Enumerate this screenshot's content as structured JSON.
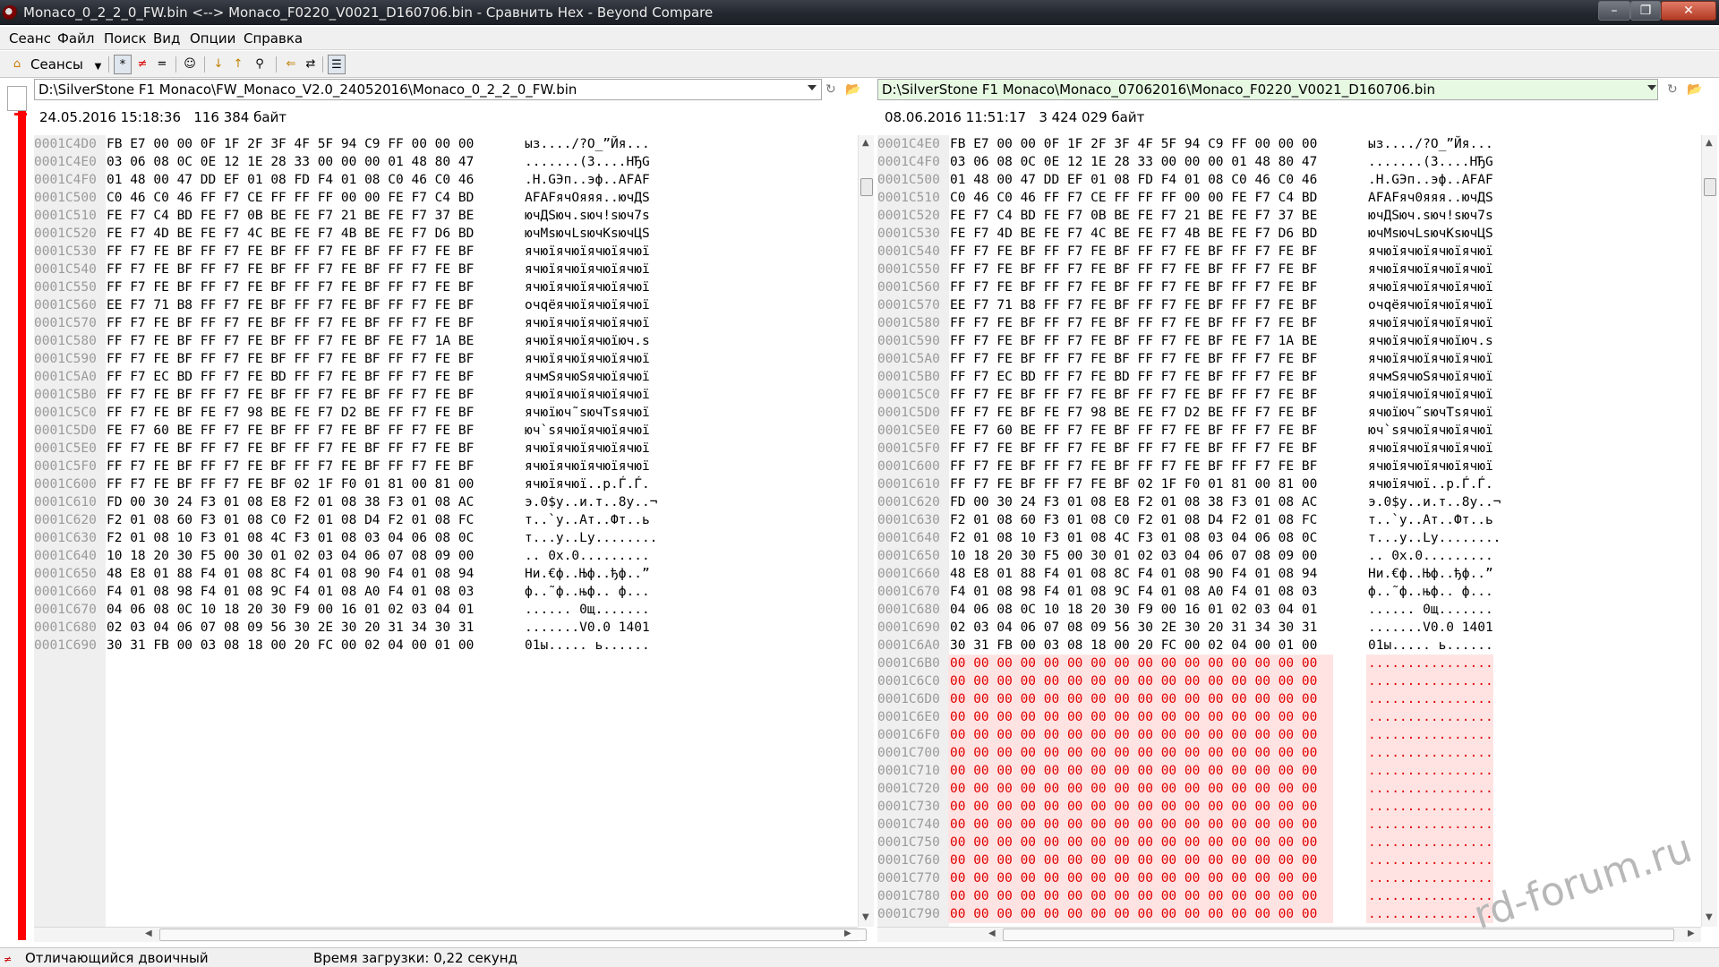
{
  "window": {
    "title": "Monaco_0_2_2_0_FW.bin <--> Monaco_F0220_V0021_D160706.bin - Сравнить Hex - Beyond Compare",
    "buttons": {
      "minimize": "–",
      "maximize": "❐",
      "close": "✕"
    }
  },
  "menu": [
    "Сеанс",
    "Файл",
    "Поиск",
    "Вид",
    "Опции",
    "Справка"
  ],
  "toolbar": {
    "sessions_label": "Сеансы",
    "icons": [
      "home-icon",
      "show-all-icon",
      "show-diffs-icon",
      "show-same-icon",
      "rules-icon",
      "prev-diff-icon",
      "next-diff-icon",
      "find-icon",
      "copy-icon",
      "swap-icon",
      "details-icon"
    ]
  },
  "left": {
    "path": "D:\\SilverStone F1 Monaco\\FW_Monaco_V2.0_24052016\\Monaco_0_2_2_0_FW.bin",
    "info": "24.05.2016 15:18:36   116 384 байт",
    "rows": [
      {
        "addr": "0001C4D0",
        "hex": "FB E7 00 00 0F 1F 2F 3F 4F 5F 94 C9 FF 00 00 00",
        "text": "ыз..../?O_”Йя..."
      },
      {
        "addr": "0001C4E0",
        "hex": "03 06 08 0C 0E 12 1E 28 33 00 00 00 01 48 80 47",
        "text": ".......(3....HЂG"
      },
      {
        "addr": "0001C4F0",
        "hex": "01 48 00 47 DD EF 01 08 FD F4 01 08 C0 46 C0 46",
        "text": ".H.GЭп..эф..AFAF"
      },
      {
        "addr": "0001C500",
        "hex": "C0 46 C0 46 FF F7 CE FF FF FF 00 00 FE F7 C4 BD",
        "text": "AFAFячОяяя..ючДЅ"
      },
      {
        "addr": "0001C510",
        "hex": "FE F7 C4 BD FE F7 0B BE FE F7 21 BE FE F7 37 BE",
        "text": "ючДЅюч.ѕюч!ѕюч7ѕ"
      },
      {
        "addr": "0001C520",
        "hex": "FE F7 4D BE FE F7 4C BE FE F7 4B BE FE F7 D6 BD",
        "text": "ючMѕючLѕючKѕючЦЅ"
      },
      {
        "addr": "0001C530",
        "hex": "FF F7 FE BF FF F7 FE BF FF F7 FE BF FF F7 FE BF",
        "text": "ячюїячюїячюїячюї"
      },
      {
        "addr": "0001C540",
        "hex": "FF F7 FE BF FF F7 FE BF FF F7 FE BF FF F7 FE BF",
        "text": "ячюїячюїячюїячюї"
      },
      {
        "addr": "0001C550",
        "hex": "FF F7 FE BF FF F7 FE BF FF F7 FE BF FF F7 FE BF",
        "text": "ячюїячюїячюїячюї"
      },
      {
        "addr": "0001C560",
        "hex": "EE F7 71 B8 FF F7 FE BF FF F7 FE BF FF F7 FE BF",
        "text": "очqёячюїячюїячюї"
      },
      {
        "addr": "0001C570",
        "hex": "FF F7 FE BF FF F7 FE BF FF F7 FE BF FF F7 FE BF",
        "text": "ячюїячюїячюїячюї"
      },
      {
        "addr": "0001C580",
        "hex": "FF F7 FE BF FF F7 FE BF FF F7 FE BF FE F7 1A BE",
        "text": "ячюїячюїячюїюч.ѕ"
      },
      {
        "addr": "0001C590",
        "hex": "FF F7 FE BF FF F7 FE BF FF F7 FE BF FF F7 FE BF",
        "text": "ячюїячюїячюїячюї"
      },
      {
        "addr": "0001C5A0",
        "hex": "FF F7 EC BD FF F7 FE BD FF F7 FE BF FF F7 FE BF",
        "text": "ячмЅячюЅячюїячюї"
      },
      {
        "addr": "0001C5B0",
        "hex": "FF F7 FE BF FF F7 FE BF FF F7 FE BF FF F7 FE BF",
        "text": "ячюїячюїячюїячюї"
      },
      {
        "addr": "0001C5C0",
        "hex": "FF F7 FE BF FE F7 98 BE FE F7 D2 BE FF F7 FE BF",
        "text": "ячюїюч˜ѕючТѕячюї"
      },
      {
        "addr": "0001C5D0",
        "hex": "FE F7 60 BE FF F7 FE BF FF F7 FE BF FF F7 FE BF",
        "text": "юч`ѕячюїячюїячюї"
      },
      {
        "addr": "0001C5E0",
        "hex": "FF F7 FE BF FF F7 FE BF FF F7 FE BF FF F7 FE BF",
        "text": "ячюїячюїячюїячюї"
      },
      {
        "addr": "0001C5F0",
        "hex": "FF F7 FE BF FF F7 FE BF FF F7 FE BF FF F7 FE BF",
        "text": "ячюїячюїячюїячюї"
      },
      {
        "addr": "0001C600",
        "hex": "FF F7 FE BF FF F7 FE BF 02 1F F0 01 81 00 81 00",
        "text": "ячюїячюї..р.Ѓ.Ѓ."
      },
      {
        "addr": "0001C610",
        "hex": "FD 00 30 24 F3 01 08 E8 F2 01 08 38 F3 01 08 AC",
        "text": "э.0$у..и.т..8у..¬"
      },
      {
        "addr": "0001C620",
        "hex": "F2 01 08 60 F3 01 08 C0 F2 01 08 D4 F2 01 08 FC",
        "text": "т..`у..Ат..Фт..ь"
      },
      {
        "addr": "0001C630",
        "hex": "F2 01 08 10 F3 01 08 4C F3 01 08 03 04 06 08 0C",
        "text": "т...у..Lу........"
      },
      {
        "addr": "0001C640",
        "hex": "10 18 20 30 F5 00 30 01 02 03 04 06 07 08 09 00",
        "text": ".. 0х.0........."
      },
      {
        "addr": "0001C650",
        "hex": "48 E8 01 88 F4 01 08 8C F4 01 08 90 F4 01 08 94",
        "text": "Ни.€ф..Њф..ђф..”"
      },
      {
        "addr": "0001C660",
        "hex": "F4 01 08 98 F4 01 08 9C F4 01 08 A0 F4 01 08 03",
        "text": "ф..˜ф..њф.. ф..."
      },
      {
        "addr": "0001C670",
        "hex": "04 06 08 0C 10 18 20 30 F9 00 16 01 02 03 04 01",
        "text": "...... 0щ......."
      },
      {
        "addr": "0001C680",
        "hex": "02 03 04 06 07 08 09 56 30 2E 30 20 31 34 30 31",
        "text": ".......V0.0 1401"
      },
      {
        "addr": "0001C690",
        "hex": "30 31 FB 00 03 08 18 00 20 FC 00 02 04 00 01 00",
        "text": "01ы..... ь......"
      }
    ]
  },
  "right": {
    "path": "D:\\SilverStone F1 Monaco\\Monaco_07062016\\Monaco_F0220_V0021_D160706.bin",
    "info": "08.06.2016 11:51:17   3 424 029 байт",
    "rows": [
      {
        "addr": "0001C4E0",
        "hex": "FB E7 00 00 0F 1F 2F 3F 4F 5F 94 C9 FF 00 00 00",
        "text": "ыз..../?O_”Йя...",
        "diff": false
      },
      {
        "addr": "0001C4F0",
        "hex": "03 06 08 0C 0E 12 1E 28 33 00 00 00 01 48 80 47",
        "text": ".......(3....HЂG",
        "diff": false
      },
      {
        "addr": "0001C500",
        "hex": "01 48 00 47 DD EF 01 08 FD F4 01 08 C0 46 C0 46",
        "text": ".H.GЭп..эф..AFAF",
        "diff": false
      },
      {
        "addr": "0001C510",
        "hex": "C0 46 C0 46 FF F7 CE FF FF FF 00 00 FE F7 C4 BD",
        "text": "AFAFяч0яяя..ючДЅ",
        "diff": false
      },
      {
        "addr": "0001C520",
        "hex": "FE F7 C4 BD FE F7 0B BE FE F7 21 BE FE F7 37 BE",
        "text": "ючДЅюч.ѕюч!ѕюч7ѕ",
        "diff": false
      },
      {
        "addr": "0001C530",
        "hex": "FE F7 4D BE FE F7 4C BE FE F7 4B BE FE F7 D6 BD",
        "text": "ючMѕючLѕючKѕючЦЅ",
        "diff": false
      },
      {
        "addr": "0001C540",
        "hex": "FF F7 FE BF FF F7 FE BF FF F7 FE BF FF F7 FE BF",
        "text": "ячюїячюїячюїячюї",
        "diff": false
      },
      {
        "addr": "0001C550",
        "hex": "FF F7 FE BF FF F7 FE BF FF F7 FE BF FF F7 FE BF",
        "text": "ячюїячюїячюїячюї",
        "diff": false
      },
      {
        "addr": "0001C560",
        "hex": "FF F7 FE BF FF F7 FE BF FF F7 FE BF FF F7 FE BF",
        "text": "ячюїячюїячюїячюї",
        "diff": false
      },
      {
        "addr": "0001C570",
        "hex": "EE F7 71 B8 FF F7 FE BF FF F7 FE BF FF F7 FE BF",
        "text": "очqёячюїячюїячюї",
        "diff": false
      },
      {
        "addr": "0001C580",
        "hex": "FF F7 FE BF FF F7 FE BF FF F7 FE BF FF F7 FE BF",
        "text": "ячюїячюїячюїячюї",
        "diff": false
      },
      {
        "addr": "0001C590",
        "hex": "FF F7 FE BF FF F7 FE BF FF F7 FE BF FE F7 1A BE",
        "text": "ячюїячюїячюїюч.ѕ",
        "diff": false
      },
      {
        "addr": "0001C5A0",
        "hex": "FF F7 FE BF FF F7 FE BF FF F7 FE BF FF F7 FE BF",
        "text": "ячюїячюїячюїячюї",
        "diff": false
      },
      {
        "addr": "0001C5B0",
        "hex": "FF F7 EC BD FF F7 FE BD FF F7 FE BF FF F7 FE BF",
        "text": "ячмЅячюЅячюїячюї",
        "diff": false
      },
      {
        "addr": "0001C5C0",
        "hex": "FF F7 FE BF FF F7 FE BF FF F7 FE BF FF F7 FE BF",
        "text": "ячюїячюїячюїячюї",
        "diff": false
      },
      {
        "addr": "0001C5D0",
        "hex": "FF F7 FE BF FE F7 98 BE FE F7 D2 BE FF F7 FE BF",
        "text": "ячюїюч˜ѕючТѕячюї",
        "diff": false
      },
      {
        "addr": "0001C5E0",
        "hex": "FE F7 60 BE FF F7 FE BF FF F7 FE BF FF F7 FE BF",
        "text": "юч`ѕячюїячюїячюї",
        "diff": false
      },
      {
        "addr": "0001C5F0",
        "hex": "FF F7 FE BF FF F7 FE BF FF F7 FE BF FF F7 FE BF",
        "text": "ячюїячюїячюїячюї",
        "diff": false
      },
      {
        "addr": "0001C600",
        "hex": "FF F7 FE BF FF F7 FE BF FF F7 FE BF FF F7 FE BF",
        "text": "ячюїячюїячюїячюї",
        "diff": false
      },
      {
        "addr": "0001C610",
        "hex": "FF F7 FE BF FF F7 FE BF 02 1F F0 01 81 00 81 00",
        "text": "ячюїячюї..р.Ѓ.Ѓ.",
        "diff": false
      },
      {
        "addr": "0001C620",
        "hex": "FD 00 30 24 F3 01 08 E8 F2 01 08 38 F3 01 08 AC",
        "text": "э.0$у..и.т..8у..¬",
        "diff": false
      },
      {
        "addr": "0001C630",
        "hex": "F2 01 08 60 F3 01 08 C0 F2 01 08 D4 F2 01 08 FC",
        "text": "т..`у..Ат..Фт..ь",
        "diff": false
      },
      {
        "addr": "0001C640",
        "hex": "F2 01 08 10 F3 01 08 4C F3 01 08 03 04 06 08 0C",
        "text": "т...у..Lу........",
        "diff": false
      },
      {
        "addr": "0001C650",
        "hex": "10 18 20 30 F5 00 30 01 02 03 04 06 07 08 09 00",
        "text": ".. 0х.0.........",
        "diff": false
      },
      {
        "addr": "0001C660",
        "hex": "48 E8 01 88 F4 01 08 8C F4 01 08 90 F4 01 08 94",
        "text": "Ни.€ф..Њф..ђф..”",
        "diff": false
      },
      {
        "addr": "0001C670",
        "hex": "F4 01 08 98 F4 01 08 9C F4 01 08 A0 F4 01 08 03",
        "text": "ф..˜ф..њф.. ф...",
        "diff": false
      },
      {
        "addr": "0001C680",
        "hex": "04 06 08 0C 10 18 20 30 F9 00 16 01 02 03 04 01",
        "text": "...... 0щ.......",
        "diff": false
      },
      {
        "addr": "0001C690",
        "hex": "02 03 04 06 07 08 09 56 30 2E 30 20 31 34 30 31",
        "text": ".......V0.0 1401",
        "diff": false
      },
      {
        "addr": "0001C6A0",
        "hex": "30 31 FB 00 03 08 18 00 20 FC 00 02 04 00 01 00",
        "text": "01ы..... ь......",
        "diff": false
      },
      {
        "addr": "0001C6B0",
        "hex": "00 00 00 00 00 00 00 00 00 00 00 00 00 00 00 00",
        "text": "................",
        "diff": true
      },
      {
        "addr": "0001C6C0",
        "hex": "00 00 00 00 00 00 00 00 00 00 00 00 00 00 00 00",
        "text": "................",
        "diff": true
      },
      {
        "addr": "0001C6D0",
        "hex": "00 00 00 00 00 00 00 00 00 00 00 00 00 00 00 00",
        "text": "................",
        "diff": true
      },
      {
        "addr": "0001C6E0",
        "hex": "00 00 00 00 00 00 00 00 00 00 00 00 00 00 00 00",
        "text": "................",
        "diff": true
      },
      {
        "addr": "0001C6F0",
        "hex": "00 00 00 00 00 00 00 00 00 00 00 00 00 00 00 00",
        "text": "................",
        "diff": true
      },
      {
        "addr": "0001C700",
        "hex": "00 00 00 00 00 00 00 00 00 00 00 00 00 00 00 00",
        "text": "................",
        "diff": true
      },
      {
        "addr": "0001C710",
        "hex": "00 00 00 00 00 00 00 00 00 00 00 00 00 00 00 00",
        "text": "................",
        "diff": true
      },
      {
        "addr": "0001C720",
        "hex": "00 00 00 00 00 00 00 00 00 00 00 00 00 00 00 00",
        "text": "................",
        "diff": true
      },
      {
        "addr": "0001C730",
        "hex": "00 00 00 00 00 00 00 00 00 00 00 00 00 00 00 00",
        "text": "................",
        "diff": true
      },
      {
        "addr": "0001C740",
        "hex": "00 00 00 00 00 00 00 00 00 00 00 00 00 00 00 00",
        "text": "................",
        "diff": true
      },
      {
        "addr": "0001C750",
        "hex": "00 00 00 00 00 00 00 00 00 00 00 00 00 00 00 00",
        "text": "................",
        "diff": true
      },
      {
        "addr": "0001C760",
        "hex": "00 00 00 00 00 00 00 00 00 00 00 00 00 00 00 00",
        "text": "................",
        "diff": true
      },
      {
        "addr": "0001C770",
        "hex": "00 00 00 00 00 00 00 00 00 00 00 00 00 00 00 00",
        "text": "................",
        "diff": true
      },
      {
        "addr": "0001C780",
        "hex": "00 00 00 00 00 00 00 00 00 00 00 00 00 00 00 00",
        "text": "................",
        "diff": true
      },
      {
        "addr": "0001C790",
        "hex": "00 00 00 00 00 00 00 00 00 00 00 00 00 00 00 00",
        "text": "................",
        "diff": true
      }
    ]
  },
  "status": {
    "mode": "Отличающийся двоичный",
    "load_time": "Время загрузки: 0,22 секунд"
  },
  "watermark": "rd-forum.ru",
  "colors": {
    "diff_text": "#e00000",
    "diff_bg": "#ffe3e3",
    "gutter": "#ff0000",
    "right_path_bg": "#e7f9e3"
  }
}
